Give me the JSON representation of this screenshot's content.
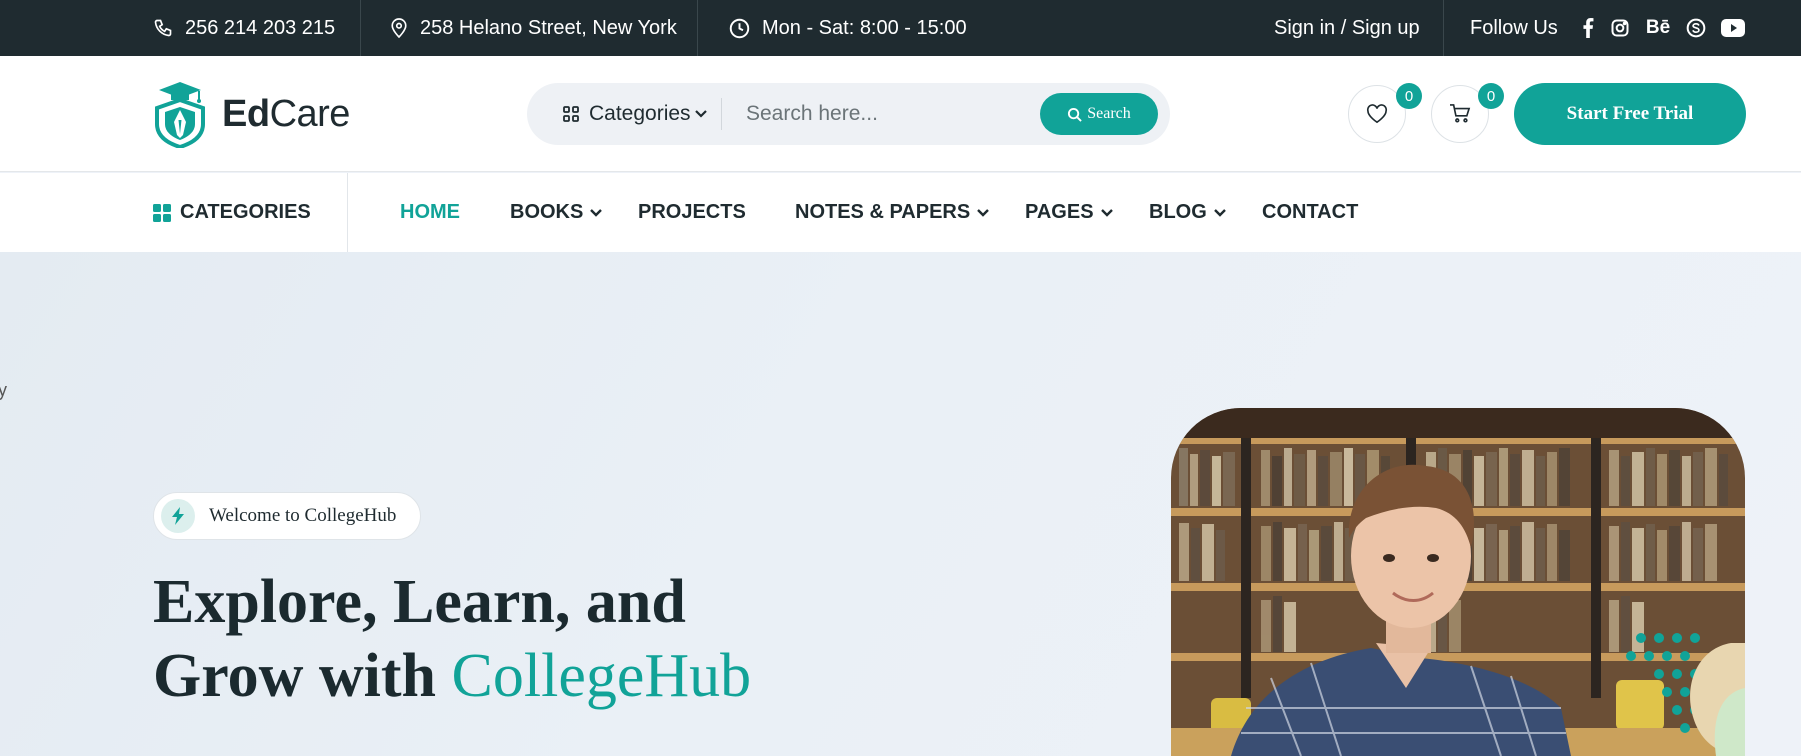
{
  "topbar": {
    "phone": "256 214 203 215",
    "address": "258 Helano Street, New York",
    "hours": "Mon - Sat: 8:00 - 15:00",
    "sign_in": "Sign in / Sign up",
    "follow_us": "Follow Us",
    "social_icons": [
      "facebook-icon",
      "instagram-icon",
      "behance-icon",
      "skype-icon",
      "youtube-icon"
    ],
    "behance_glyph": "Bē"
  },
  "header": {
    "logo_ed": "Ed",
    "logo_care": "Care",
    "categories_label": "Categories",
    "search_placeholder": "Search here...",
    "search_button": "Search",
    "wishlist_count": "0",
    "cart_count": "0",
    "trial_button": "Start Free Trial"
  },
  "nav": {
    "categories": "CATEGORIES",
    "items": [
      {
        "label": "HOME",
        "active": true
      },
      {
        "label": "BOOKS"
      },
      {
        "label": "PROJECTS"
      },
      {
        "label": "NOTES & PAPERS"
      },
      {
        "label": "PAGES"
      },
      {
        "label": "BLOG"
      },
      {
        "label": "CONTACT"
      }
    ]
  },
  "hero": {
    "stray_char": "y",
    "welcome": "Welcome to CollegeHub",
    "title_line1": "Explore, Learn, and",
    "title_line2_prefix": "Grow with ",
    "title_accent": "CollegeHub"
  },
  "colors": {
    "accent": "#11a398",
    "topbar_bg": "#1f2b30",
    "text_dark": "#1b2a2f"
  }
}
